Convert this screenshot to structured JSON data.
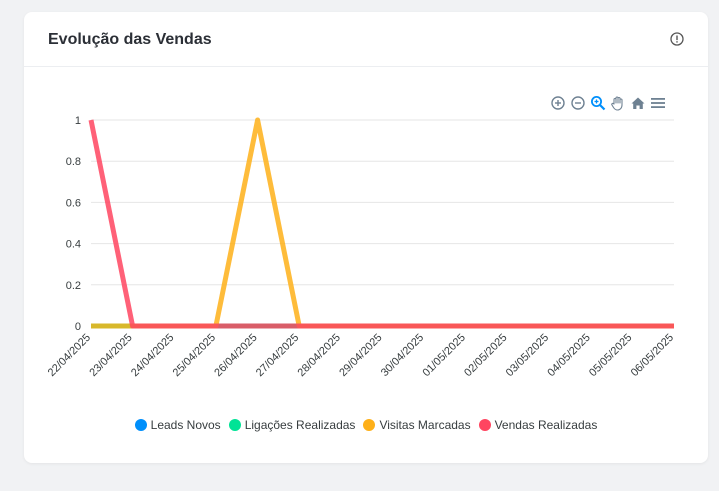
{
  "card": {
    "title": "Evolução das Vendas"
  },
  "colors": {
    "leads": "#008ffb",
    "ligacoes": "#00e396",
    "visitas": "#feb019",
    "vendas": "#ff4560",
    "grid": "#e6e6e6",
    "icon": "#6e8192",
    "icon_active": "#008ffb"
  },
  "icons": {
    "info": "info-icon",
    "toolbar": [
      "zoom-in-icon",
      "zoom-out-icon",
      "selection-zoom-icon",
      "pan-hand-icon",
      "reset-home-icon",
      "menu-icon"
    ]
  },
  "chart_data": {
    "type": "line",
    "categories": [
      "22/04/2025",
      "23/04/2025",
      "24/04/2025",
      "25/04/2025",
      "26/04/2025",
      "27/04/2025",
      "28/04/2025",
      "29/04/2025",
      "30/04/2025",
      "01/05/2025",
      "02/05/2025",
      "03/05/2025",
      "04/05/2025",
      "05/05/2025",
      "06/05/2025"
    ],
    "y_ticks": [
      "0",
      "0.2",
      "0.4",
      "0.6",
      "0.8",
      "1"
    ],
    "ylim": [
      0,
      1
    ],
    "grid": true,
    "legend_position": "bottom",
    "series": [
      {
        "name": "Leads Novos",
        "color": "#008ffb",
        "values": [
          0,
          0,
          0,
          0,
          0,
          0,
          0,
          0,
          0,
          0,
          0,
          0,
          0,
          0,
          0
        ]
      },
      {
        "name": "Ligações Realizadas",
        "color": "#00e396",
        "values": [
          0,
          0,
          0,
          0,
          0,
          0,
          0,
          0,
          0,
          0,
          0,
          0,
          0,
          0,
          0
        ]
      },
      {
        "name": "Visitas Marcadas",
        "color": "#feb019",
        "values": [
          0,
          0,
          0,
          0,
          1,
          0,
          0,
          0,
          0,
          0,
          0,
          0,
          0,
          0,
          0
        ]
      },
      {
        "name": "Vendas Realizadas",
        "color": "#ff4560",
        "values": [
          1,
          0,
          0,
          0,
          0,
          0,
          0,
          0,
          0,
          0,
          0,
          0,
          0,
          0,
          0
        ]
      }
    ]
  }
}
